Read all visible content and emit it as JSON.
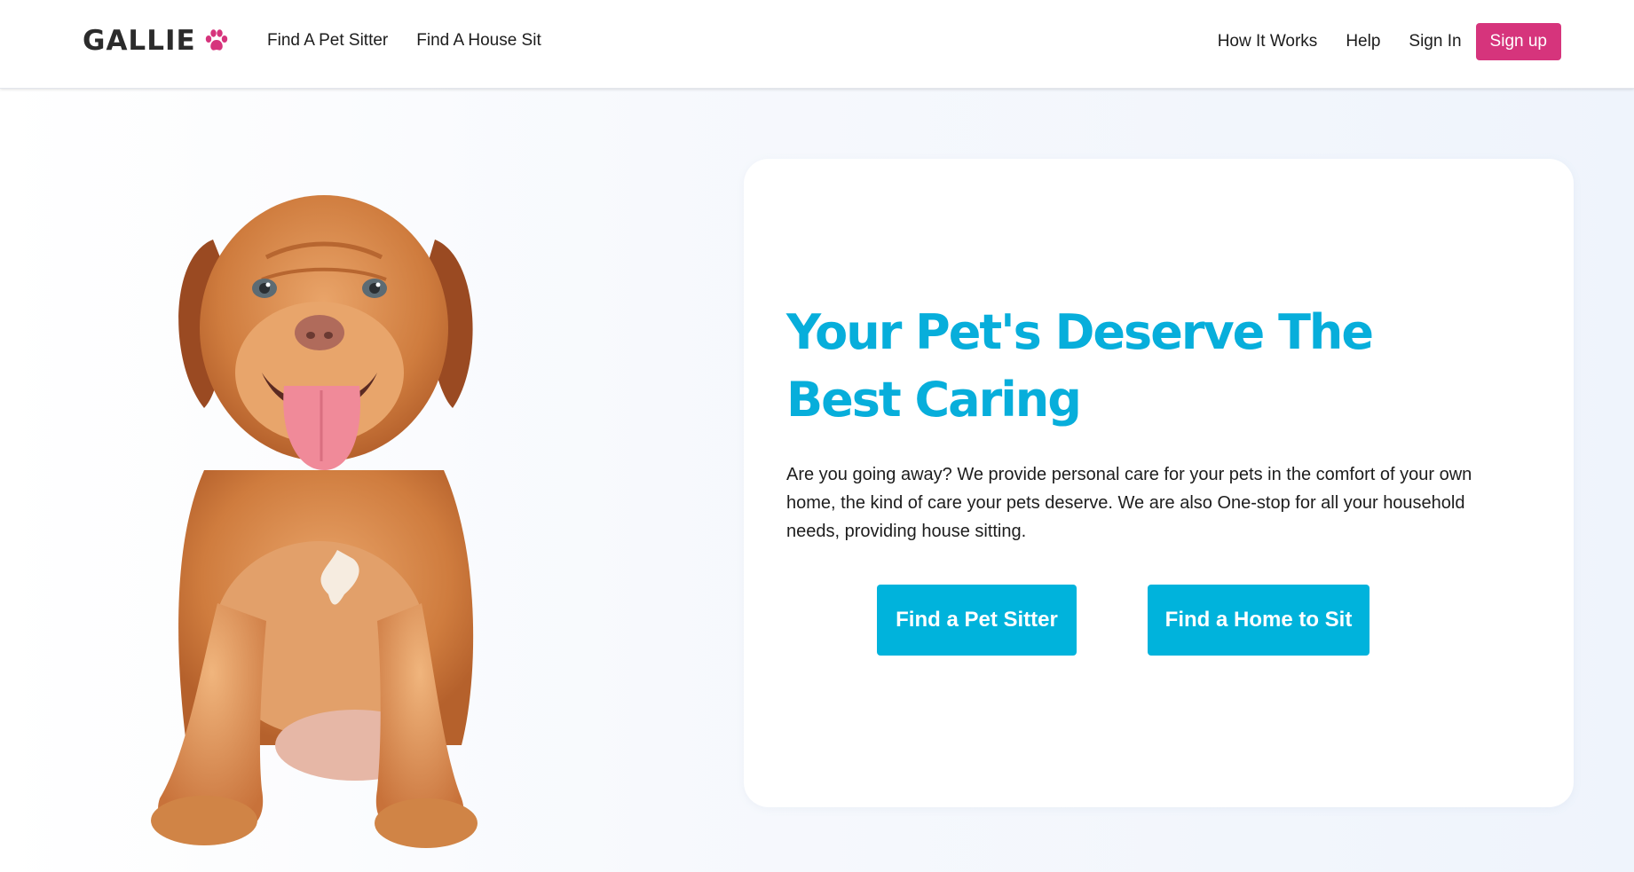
{
  "brand": {
    "name": "GALLIE",
    "accent": "#d6347c",
    "primary": "#00b3dc"
  },
  "nav": {
    "left": [
      "Find A Pet Sitter",
      "Find A House Sit"
    ],
    "right": [
      "How It Works",
      "Help",
      "Sign In"
    ],
    "signup_label": "Sign up"
  },
  "hero": {
    "title": "Your Pet's Deserve The Best Caring",
    "text": "Are you going away? We provide personal care for your pets in the comfort of your own home, the kind of care your pets deserve. We are also One-stop for all your household needs, providing house sitting.",
    "cta_sitter": "Find a Pet Sitter",
    "cta_home": "Find a Home to Sit"
  },
  "icons": {
    "logo": "paw-icon"
  }
}
